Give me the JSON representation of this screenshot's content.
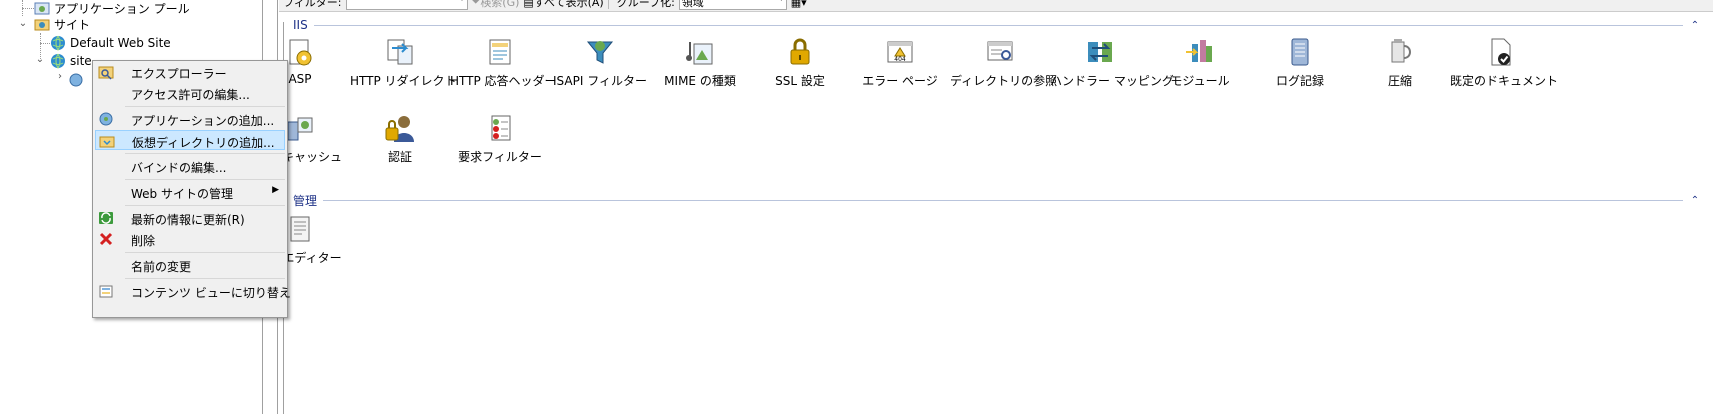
{
  "toolbar": {
    "filter_label": "フィルター:",
    "search_label": "検索(G)",
    "show_all_label": "すべて表示(A)",
    "group_by_label": "グループ化:",
    "group_by_value": "領域"
  },
  "tree": {
    "app_pools": "アプリケーション プール",
    "sites": "サイト",
    "default_site": "Default Web Site",
    "site": "site"
  },
  "groups": {
    "iis": "IIS",
    "management": "管理"
  },
  "features_iis": [
    {
      "label": "ASP",
      "icon": "asp-icon"
    },
    {
      "label": "HTTP リダイレクト",
      "icon": "http-redirect-icon"
    },
    {
      "label": "HTTP 応答ヘッダー",
      "icon": "http-response-headers-icon"
    },
    {
      "label": "ISAPI フィルター",
      "icon": "isapi-filter-icon"
    },
    {
      "label": "MIME の種類",
      "icon": "mime-types-icon"
    },
    {
      "label": "SSL 設定",
      "icon": "ssl-lock-icon"
    },
    {
      "label": "エラー ページ",
      "icon": "error-page-404-icon"
    },
    {
      "label": "ディレクトリの参照",
      "icon": "directory-browse-icon"
    },
    {
      "label": "ハンドラー マッピング",
      "icon": "handler-mapping-icon"
    },
    {
      "label": "モジュール",
      "icon": "modules-icon"
    },
    {
      "label": "ログ記録",
      "icon": "logging-icon"
    },
    {
      "label": "圧縮",
      "icon": "compression-icon"
    },
    {
      "label": "既定のドキュメント",
      "icon": "default-document-icon"
    },
    {
      "label": "出力キャッシュ",
      "icon": "output-cache-icon"
    },
    {
      "label": "認証",
      "icon": "authentication-icon"
    },
    {
      "label": "要求フィルター",
      "icon": "request-filter-icon"
    }
  ],
  "features_mgmt": [
    {
      "label": "構成エディター",
      "icon": "config-editor-icon"
    }
  ],
  "context_menu": {
    "explore": "エクスプローラー",
    "edit_permissions": "アクセス許可の編集...",
    "add_application": "アプリケーションの追加...",
    "add_virtual_dir": "仮想ディレクトリの追加...",
    "edit_bindings": "バインドの編集...",
    "manage_site": "Web サイトの管理",
    "refresh": "最新の情報に更新(R)",
    "delete": "削除",
    "rename": "名前の変更",
    "switch_content_view": "コンテンツ ビューに切り替え"
  }
}
